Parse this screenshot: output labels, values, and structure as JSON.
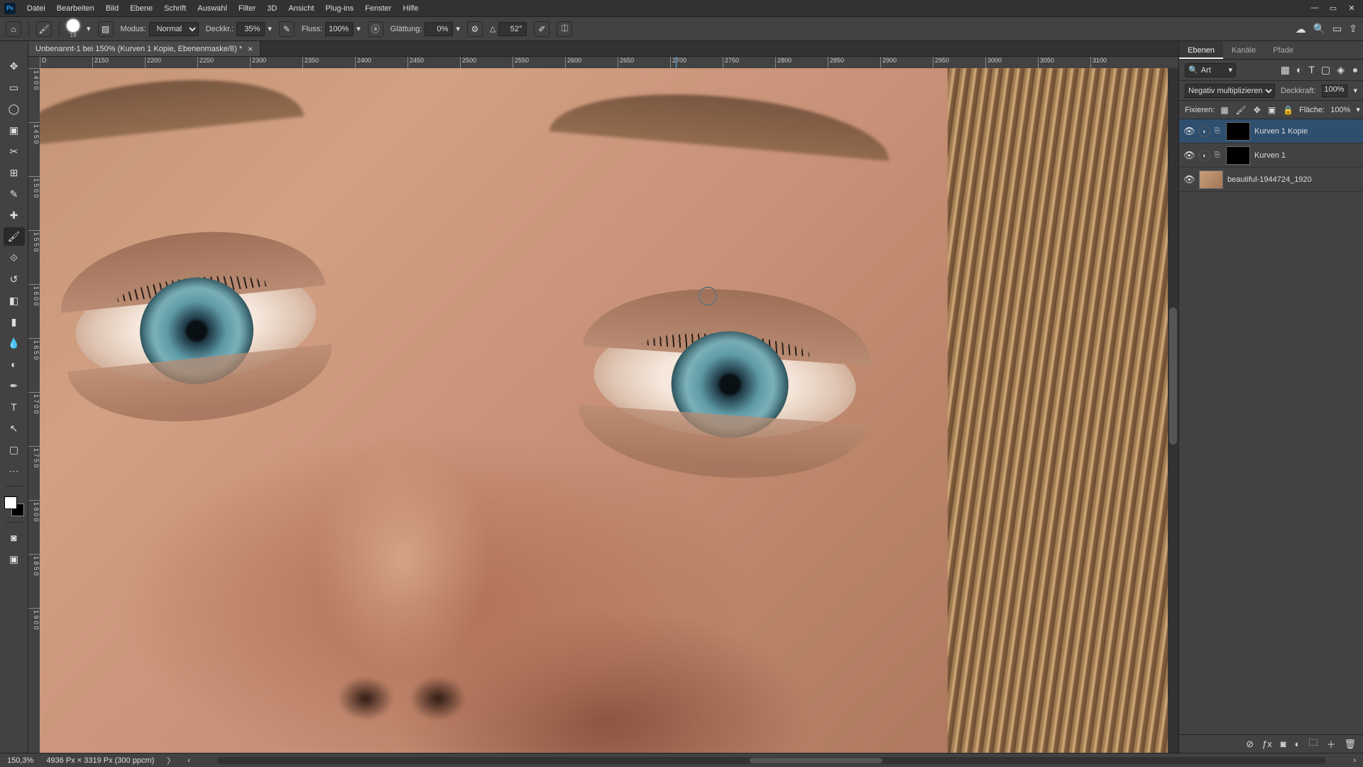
{
  "menu": {
    "items": [
      "Datei",
      "Bearbeiten",
      "Bild",
      "Ebene",
      "Schrift",
      "Auswahl",
      "Filter",
      "3D",
      "Ansicht",
      "Plug-ins",
      "Fenster",
      "Hilfe"
    ]
  },
  "options": {
    "brush_size": "19",
    "modus_label": "Modus:",
    "modus_value": "Normal",
    "deckkr_label": "Deckkr.:",
    "deckkr_value": "35%",
    "fluss_label": "Fluss:",
    "fluss_value": "100%",
    "glaettung_label": "Glättung:",
    "glaettung_value": "0%",
    "angle_value": "52°"
  },
  "doc": {
    "tab_title": "Unbenannt-1 bei 150% (Kurven 1 Kopie, Ebenenmaske/8) *"
  },
  "ruler": {
    "h_ticks": [
      "D",
      "2150",
      "2200",
      "2250",
      "2300",
      "2350",
      "2400",
      "2450",
      "2500",
      "2550",
      "2600",
      "2650",
      "2700",
      "2750",
      "2800",
      "2850",
      "2900",
      "2950",
      "3000",
      "3050",
      "3100"
    ],
    "v_ticks": [
      "1 4 0 0",
      "1 4 5 0",
      "1 5 0 0",
      "1 5 5 0",
      "1 6 0 0",
      "1 6 5 0",
      "1 7 0 0",
      "1 7 5 0",
      "1 8 0 0",
      "1 8 5 0",
      "1 9 0 0"
    ]
  },
  "panels": {
    "tabs": [
      "Ebenen",
      "Kanäle",
      "Pfade"
    ],
    "search_label": "Art",
    "blend_mode": "Negativ multiplizieren",
    "deckkraft_label": "Deckkraft:",
    "deckkraft_value": "100%",
    "fixieren_label": "Fixieren:",
    "flaeche_label": "Fläche:",
    "flaeche_value": "100%",
    "layers": [
      {
        "name": "Kurven 1 Kopie",
        "thumb": "mask",
        "has_adj": true,
        "selected": true
      },
      {
        "name": "Kurven 1",
        "thumb": "mask",
        "has_adj": true,
        "selected": false
      },
      {
        "name": "beautiful-1944724_1920",
        "thumb": "img",
        "has_adj": false,
        "selected": false
      }
    ]
  },
  "status": {
    "zoom": "150,3%",
    "doc_info": "4936 Px × 3319 Px (300 ppcm)"
  }
}
